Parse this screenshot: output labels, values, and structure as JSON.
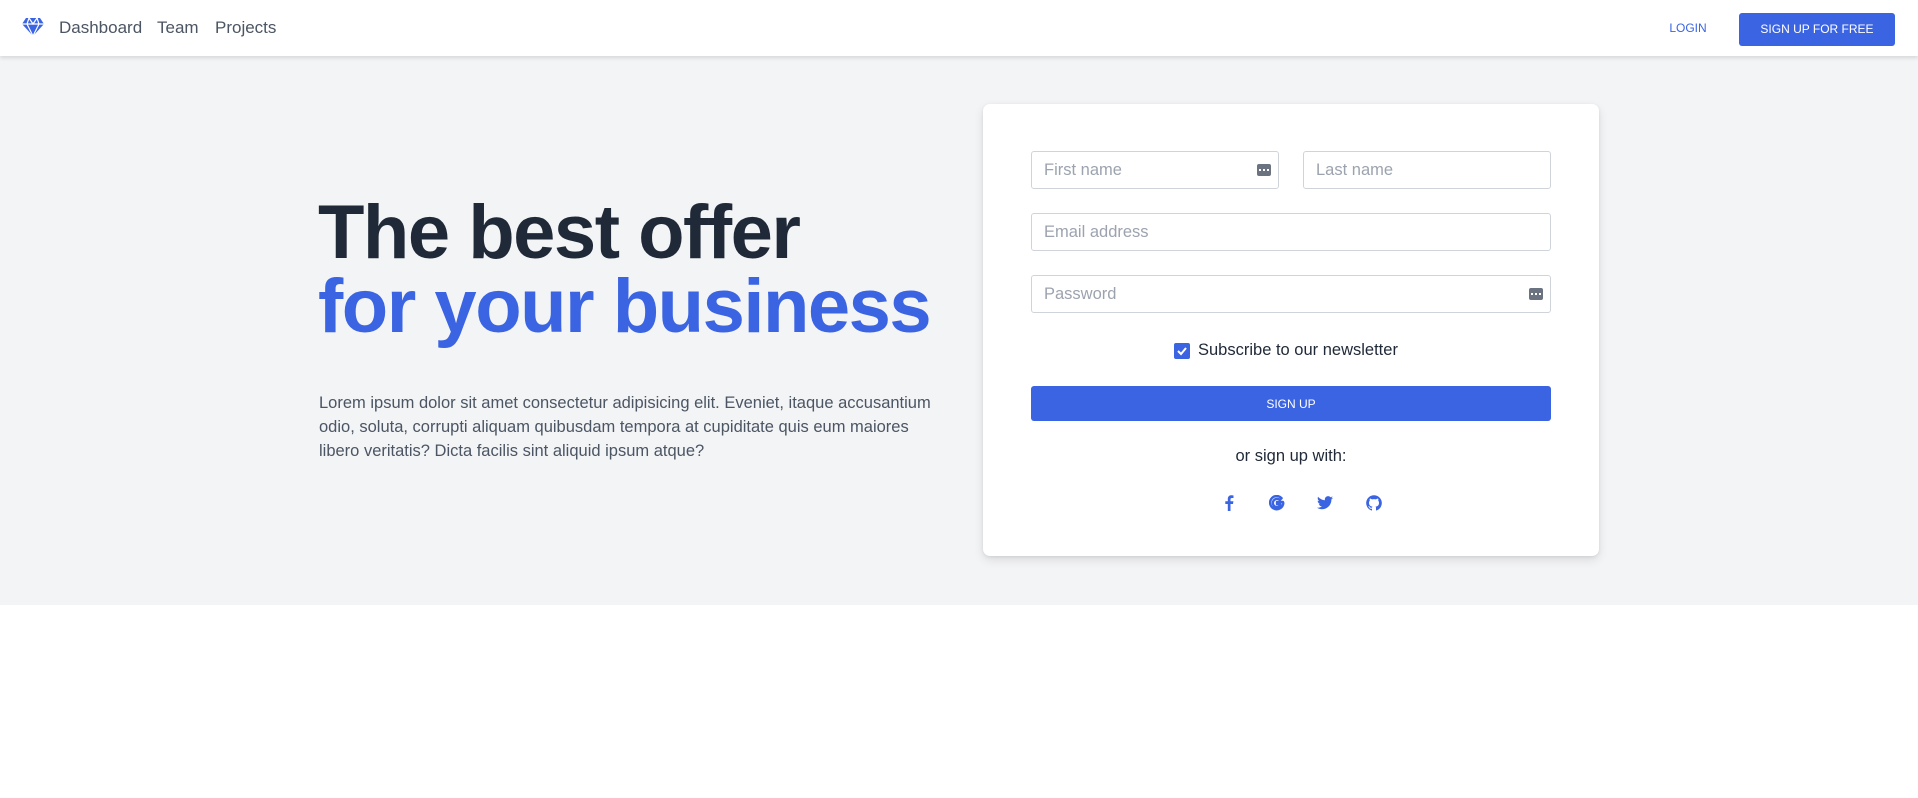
{
  "nav": {
    "items": [
      "Dashboard",
      "Team",
      "Projects"
    ],
    "login_label": "LOGIN",
    "signup_free_label": "SIGN UP FOR FREE"
  },
  "hero": {
    "headline_line1": "The best offer",
    "headline_line2": "for your business",
    "description": "Lorem ipsum dolor sit amet consectetur adipisicing elit. Eveniet, itaque accusantium odio, soluta, corrupti aliquam quibusdam tempora at cupiditate quis eum maiores libero veritatis? Dicta facilis sint aliquid ipsum atque?"
  },
  "form": {
    "first_name_placeholder": "First name",
    "last_name_placeholder": "Last name",
    "email_placeholder": "Email address",
    "password_placeholder": "Password",
    "newsletter_label": "Subscribe to our newsletter",
    "newsletter_checked": true,
    "submit_label": "SIGN UP",
    "social_text": "or sign up with:",
    "social_icons": [
      "facebook-icon",
      "google-icon",
      "twitter-icon",
      "github-icon"
    ]
  },
  "colors": {
    "primary": "#3b64e3",
    "heading": "#1f2937",
    "hero_bg": "#f3f4f6"
  }
}
